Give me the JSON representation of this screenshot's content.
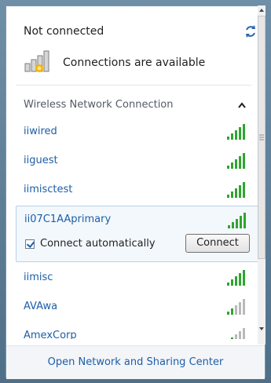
{
  "header": {
    "status": "Not connected",
    "available": "Connections are available"
  },
  "section": {
    "title": "Wireless Network Connection"
  },
  "networks": [
    {
      "name": "iiwired",
      "signal": 4
    },
    {
      "name": "iiguest",
      "signal": 4
    },
    {
      "name": "iimisctest",
      "signal": 4
    },
    {
      "name": "ii07C1AAprimary",
      "signal": 4,
      "selected": true,
      "auto_connect_label": "Connect automatically",
      "connect_label": "Connect"
    },
    {
      "name": "iimisc",
      "signal": 4
    },
    {
      "name": "AVAwa",
      "signal": 2
    },
    {
      "name": "AmexCorp",
      "signal": 2
    }
  ],
  "footer": {
    "link": "Open Network and Sharing Center"
  },
  "colors": {
    "link": "#1d5ea8",
    "signal_on": "#2fa52f",
    "signal_off": "#b9b9b9"
  }
}
